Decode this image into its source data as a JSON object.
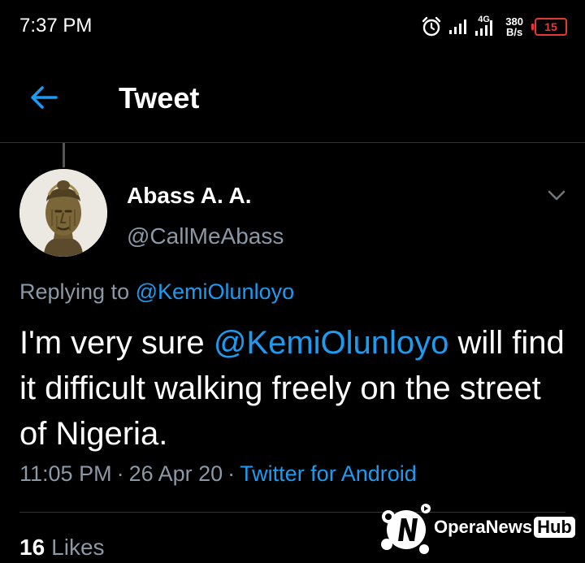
{
  "status_bar": {
    "time": "7:37 PM",
    "network": "4G",
    "speed_value": "380",
    "speed_unit": "B/s",
    "battery": "15",
    "icons": [
      "alarm-icon",
      "signal-icon",
      "4g-signal-icon",
      "battery-icon"
    ]
  },
  "header": {
    "title": "Tweet",
    "back_icon": "arrow-left-icon"
  },
  "tweet": {
    "author_name": "Abass A. A.",
    "author_handle": "@CallMeAbass",
    "replying_prefix": "Replying to",
    "replying_to": "@KemiOlunloyo",
    "text_before": "I'm very sure",
    "mention": "@KemiOlunloyo",
    "text_after": "will find it difficult walking freely on the street of Nigeria.",
    "time": "11:05 PM",
    "date": "26 Apr 20",
    "source": "Twitter for Android",
    "separator": "·"
  },
  "stats": {
    "likes_count": "16",
    "likes_label": "Likes"
  },
  "watermark": {
    "brand": "OperaNews",
    "hub": "Hub"
  },
  "colors": {
    "background": "#000000",
    "accent": "#1d9bf0",
    "muted_text": "#8b98a5",
    "battery_low": "#e53935"
  }
}
